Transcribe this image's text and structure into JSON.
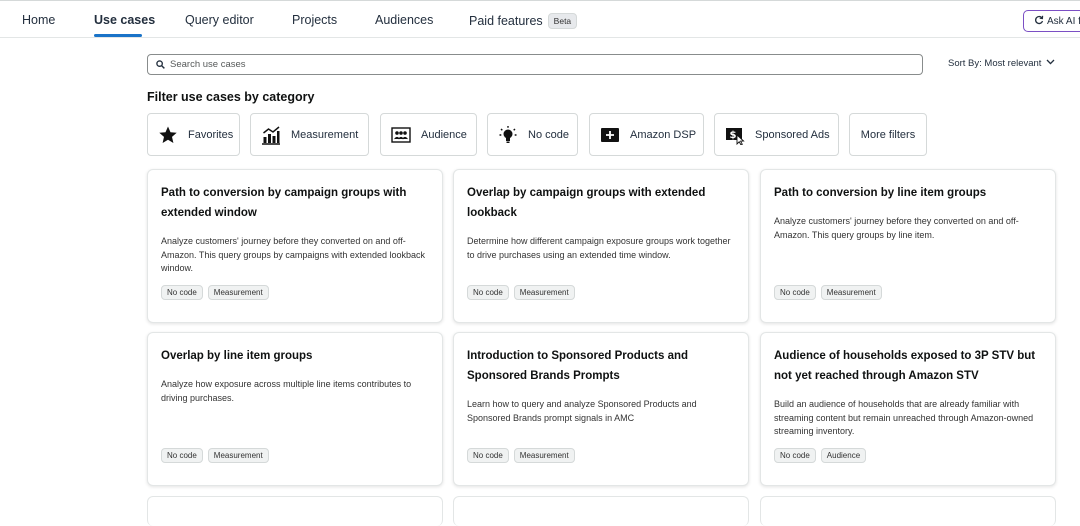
{
  "nav": {
    "items": [
      {
        "label": "Home"
      },
      {
        "label": "Use cases"
      },
      {
        "label": "Query editor"
      },
      {
        "label": "Projects"
      },
      {
        "label": "Audiences"
      },
      {
        "label": "Paid features"
      }
    ],
    "beta_label": "Beta",
    "active": "Use cases",
    "ask_ai_label": "Ask AI f"
  },
  "search": {
    "placeholder": "Search use cases",
    "value": ""
  },
  "sort": {
    "label": "Sort By: Most relevant"
  },
  "filters": {
    "title": "Filter use cases by category",
    "chips": [
      {
        "label": "Favorites",
        "icon": "star-icon"
      },
      {
        "label": "Measurement",
        "icon": "chart-icon"
      },
      {
        "label": "Audience",
        "icon": "audience-icon"
      },
      {
        "label": "No code",
        "icon": "lightbulb-icon"
      },
      {
        "label": "Amazon DSP",
        "icon": "dsp-icon"
      },
      {
        "label": "Sponsored Ads",
        "icon": "sponsored-ads-icon"
      },
      {
        "label": "More filters"
      }
    ]
  },
  "cards": [
    {
      "title": "Path to conversion by campaign groups with extended window",
      "description": "Analyze customers' journey before they converted on and off-Amazon. This query groups by campaigns with extended lookback window.",
      "tags": [
        "No code",
        "Measurement"
      ]
    },
    {
      "title": "Overlap by campaign groups with extended lookback",
      "description": "Determine how different campaign exposure groups work together to drive purchases using an extended time window.",
      "tags": [
        "No code",
        "Measurement"
      ]
    },
    {
      "title": "Path to conversion by line item groups",
      "description": "Analyze customers' journey before they converted on and off-Amazon. This query groups by line item.",
      "tags": [
        "No code",
        "Measurement"
      ]
    },
    {
      "title": "Overlap by line item groups",
      "description": "Analyze how exposure across multiple line items contributes to driving purchases.",
      "tags": [
        "No code",
        "Measurement"
      ]
    },
    {
      "title": "Introduction to Sponsored Products and Sponsored Brands Prompts",
      "description": "Learn how to query and analyze Sponsored Products and Sponsored Brands prompt signals in AMC",
      "tags": [
        "No code",
        "Measurement"
      ]
    },
    {
      "title": "Audience of households exposed to 3P STV but not yet reached through Amazon STV",
      "description": "Build an audience of households that are already familiar with streaming content but remain unreached through Amazon-owned streaming inventory.",
      "tags": [
        "No code",
        "Audience"
      ]
    }
  ],
  "colors": {
    "accent": "#1a73c8",
    "ask_ai_border": "#7b4fc4"
  }
}
